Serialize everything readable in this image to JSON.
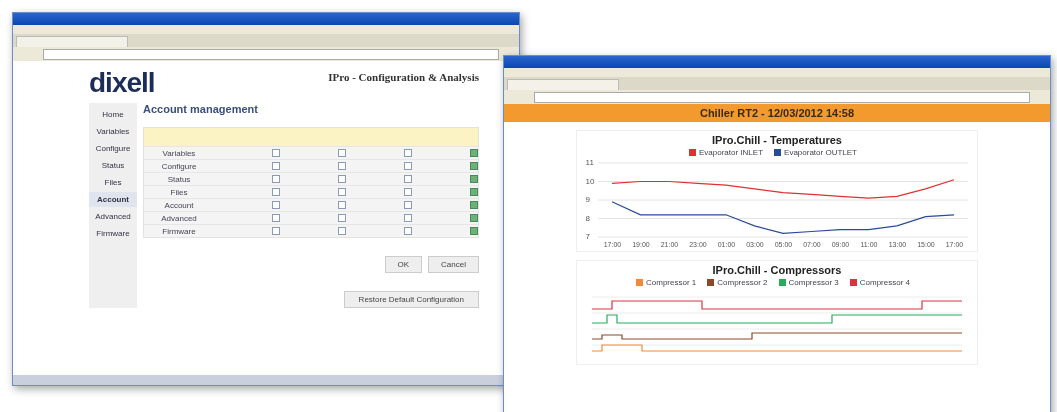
{
  "config_window": {
    "logo": "dixell",
    "page_title": "IPro - Configuration & Analysis",
    "sidebar": {
      "items": [
        {
          "label": "Home",
          "selected": false
        },
        {
          "label": "Variables",
          "selected": false
        },
        {
          "label": "Configure",
          "selected": false
        },
        {
          "label": "Status",
          "selected": false
        },
        {
          "label": "Files",
          "selected": false
        },
        {
          "label": "Account",
          "selected": true
        },
        {
          "label": "Advanced",
          "selected": false
        },
        {
          "label": "Firmware",
          "selected": false
        }
      ]
    },
    "heading": "Account management",
    "table": {
      "rows": [
        {
          "name": "Variables",
          "access": [
            false,
            false,
            false,
            true
          ]
        },
        {
          "name": "Configure",
          "access": [
            false,
            false,
            false,
            true
          ]
        },
        {
          "name": "Status",
          "access": [
            false,
            false,
            false,
            true
          ]
        },
        {
          "name": "Files",
          "access": [
            false,
            false,
            false,
            true
          ]
        },
        {
          "name": "Account",
          "access": [
            false,
            false,
            false,
            true
          ]
        },
        {
          "name": "Advanced",
          "access": [
            false,
            false,
            false,
            true
          ]
        },
        {
          "name": "Firmware",
          "access": [
            false,
            false,
            false,
            true
          ]
        }
      ]
    },
    "buttons": [
      {
        "label": "OK"
      },
      {
        "label": "Cancel"
      }
    ],
    "restore_button": "Restore Default Configuration"
  },
  "chart_window": {
    "header": "Chiller RT2 - 12/03/2012 14:58",
    "charts": [
      {
        "kind": "temperature",
        "title": "IPro.Chill - Temperatures",
        "chart_data": {
          "type": "line",
          "grid": true,
          "categories": [
            "17:00",
            "19:00",
            "21:00",
            "23:00",
            "01:00",
            "03:00",
            "05:00",
            "07:00",
            "09:00",
            "11:00",
            "13:00",
            "15:00",
            "17:00"
          ],
          "ylim": [
            7,
            11
          ],
          "yticks": [
            7,
            8,
            9,
            10,
            11
          ],
          "series": [
            {
              "name": "Evaporator INLET",
              "color": "#e03030",
              "values": [
                9.9,
                10,
                10,
                9.9,
                9.8,
                9.6,
                9.4,
                9.3,
                9.2,
                9.1,
                9.2,
                9.6,
                10.1
              ]
            },
            {
              "name": "Evaporator OUTLET",
              "color": "#2a4a9a",
              "values": [
                8.9,
                8.2,
                8.2,
                8.2,
                8.2,
                7.6,
                7.2,
                7.3,
                7.4,
                7.4,
                7.6,
                8.1,
                8.2
              ]
            }
          ]
        }
      },
      {
        "kind": "compressor",
        "title": "IPro.Chill - Compressors",
        "legend": [
          {
            "label": "Compressor 1",
            "color": "#f08a3a"
          },
          {
            "label": "Compressor 2",
            "color": "#8a4a2a"
          },
          {
            "label": "Compressor 3",
            "color": "#2aaa5a"
          },
          {
            "label": "Compressor 4",
            "color": "#e03040"
          }
        ]
      }
    ]
  }
}
